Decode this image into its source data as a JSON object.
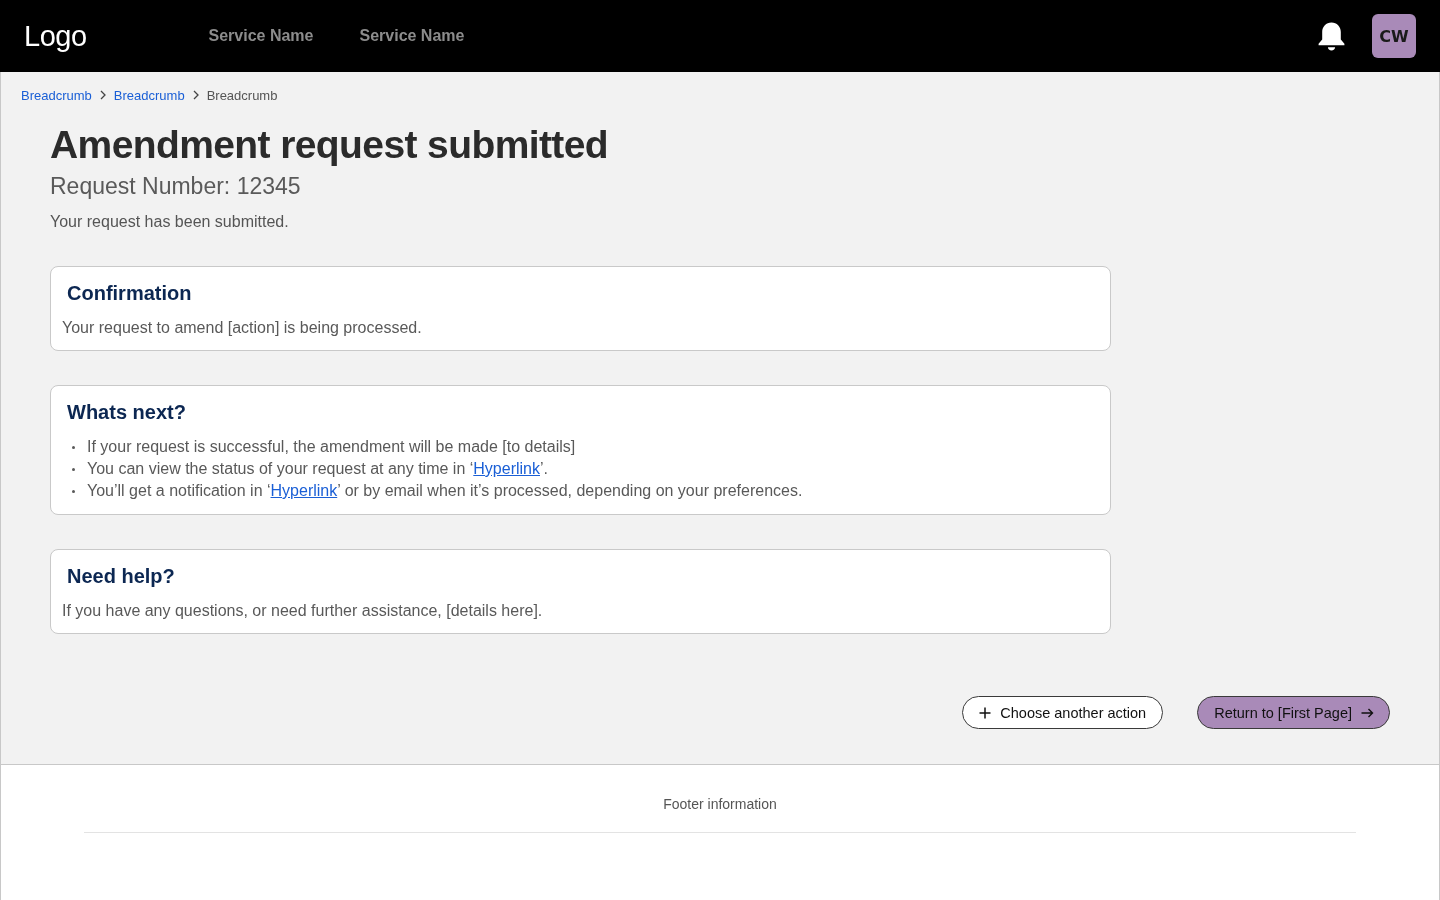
{
  "header": {
    "logo": "Logo",
    "nav": [
      {
        "label": "Service Name"
      },
      {
        "label": "Service Name"
      }
    ],
    "avatar": {
      "initials": "CW"
    }
  },
  "breadcrumbs": [
    {
      "label": "Breadcrumb",
      "current": false
    },
    {
      "label": "Breadcrumb",
      "current": false
    },
    {
      "label": "Breadcrumb",
      "current": true
    }
  ],
  "title": "Amendment request submitted",
  "request_number": "Request Number: 12345",
  "intro": "Your request has been submitted.",
  "panels": [
    {
      "kind": "text",
      "heading": "Confirmation",
      "text": "Your request to amend [action] is being processed."
    },
    {
      "kind": "list",
      "heading": "Whats next?",
      "items": [
        {
          "text": "If your request is successful, the amendment will be made [to details]"
        },
        {
          "text": "You can view the status of your request at any time in ‘",
          "link": "Hyperlink",
          "after": "’."
        },
        {
          "text": "You’ll get a notification in ‘",
          "link": "Hyperlink",
          "after": "’ or by email when it’s processed, depending on your preferences."
        }
      ]
    },
    {
      "kind": "text",
      "heading": "Need help?",
      "text": "If you have any questions, or need further assistance, [details here]."
    }
  ],
  "actions": [
    {
      "kind": "secondary",
      "label": "Choose another action"
    },
    {
      "kind": "primary",
      "label": "Return to [First Page]"
    }
  ],
  "footer": {
    "text": "Footer information"
  }
}
